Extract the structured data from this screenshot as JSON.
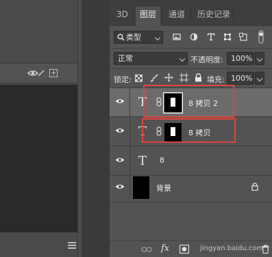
{
  "tabs": [
    {
      "label": "3D",
      "active": false
    },
    {
      "label": "图层",
      "active": true
    },
    {
      "label": "通道",
      "active": false
    },
    {
      "label": "历史记录",
      "active": false
    }
  ],
  "filter": {
    "label": "类型",
    "icons": [
      "image-filter-icon",
      "adjustment-filter-icon",
      "type-filter-icon",
      "shape-filter-icon",
      "smart-object-filter-icon"
    ]
  },
  "blend": {
    "mode": "正常",
    "opacity_label": "不透明度:",
    "opacity_value": "100%"
  },
  "lock": {
    "label": "锁定:",
    "fill_label": "填充:",
    "fill_value": "100%"
  },
  "layers": [
    {
      "name": "8 拷贝 2",
      "type": "text",
      "mask": true,
      "selected": true,
      "highlighted": true
    },
    {
      "name": "8 拷贝",
      "type": "text",
      "mask": true,
      "selected": false,
      "highlighted": true
    },
    {
      "name": "8",
      "type": "text",
      "mask": false,
      "selected": false,
      "highlighted": false
    },
    {
      "name": "背景",
      "type": "background",
      "locked": true,
      "selected": false,
      "highlighted": false
    }
  ],
  "bottom": {
    "fx_label": "fx",
    "watermark": "jingyan.baidu.com"
  },
  "colors": {
    "panel": "#535353",
    "selected_row": "#6b6b6b",
    "highlight": "#e0453f"
  }
}
